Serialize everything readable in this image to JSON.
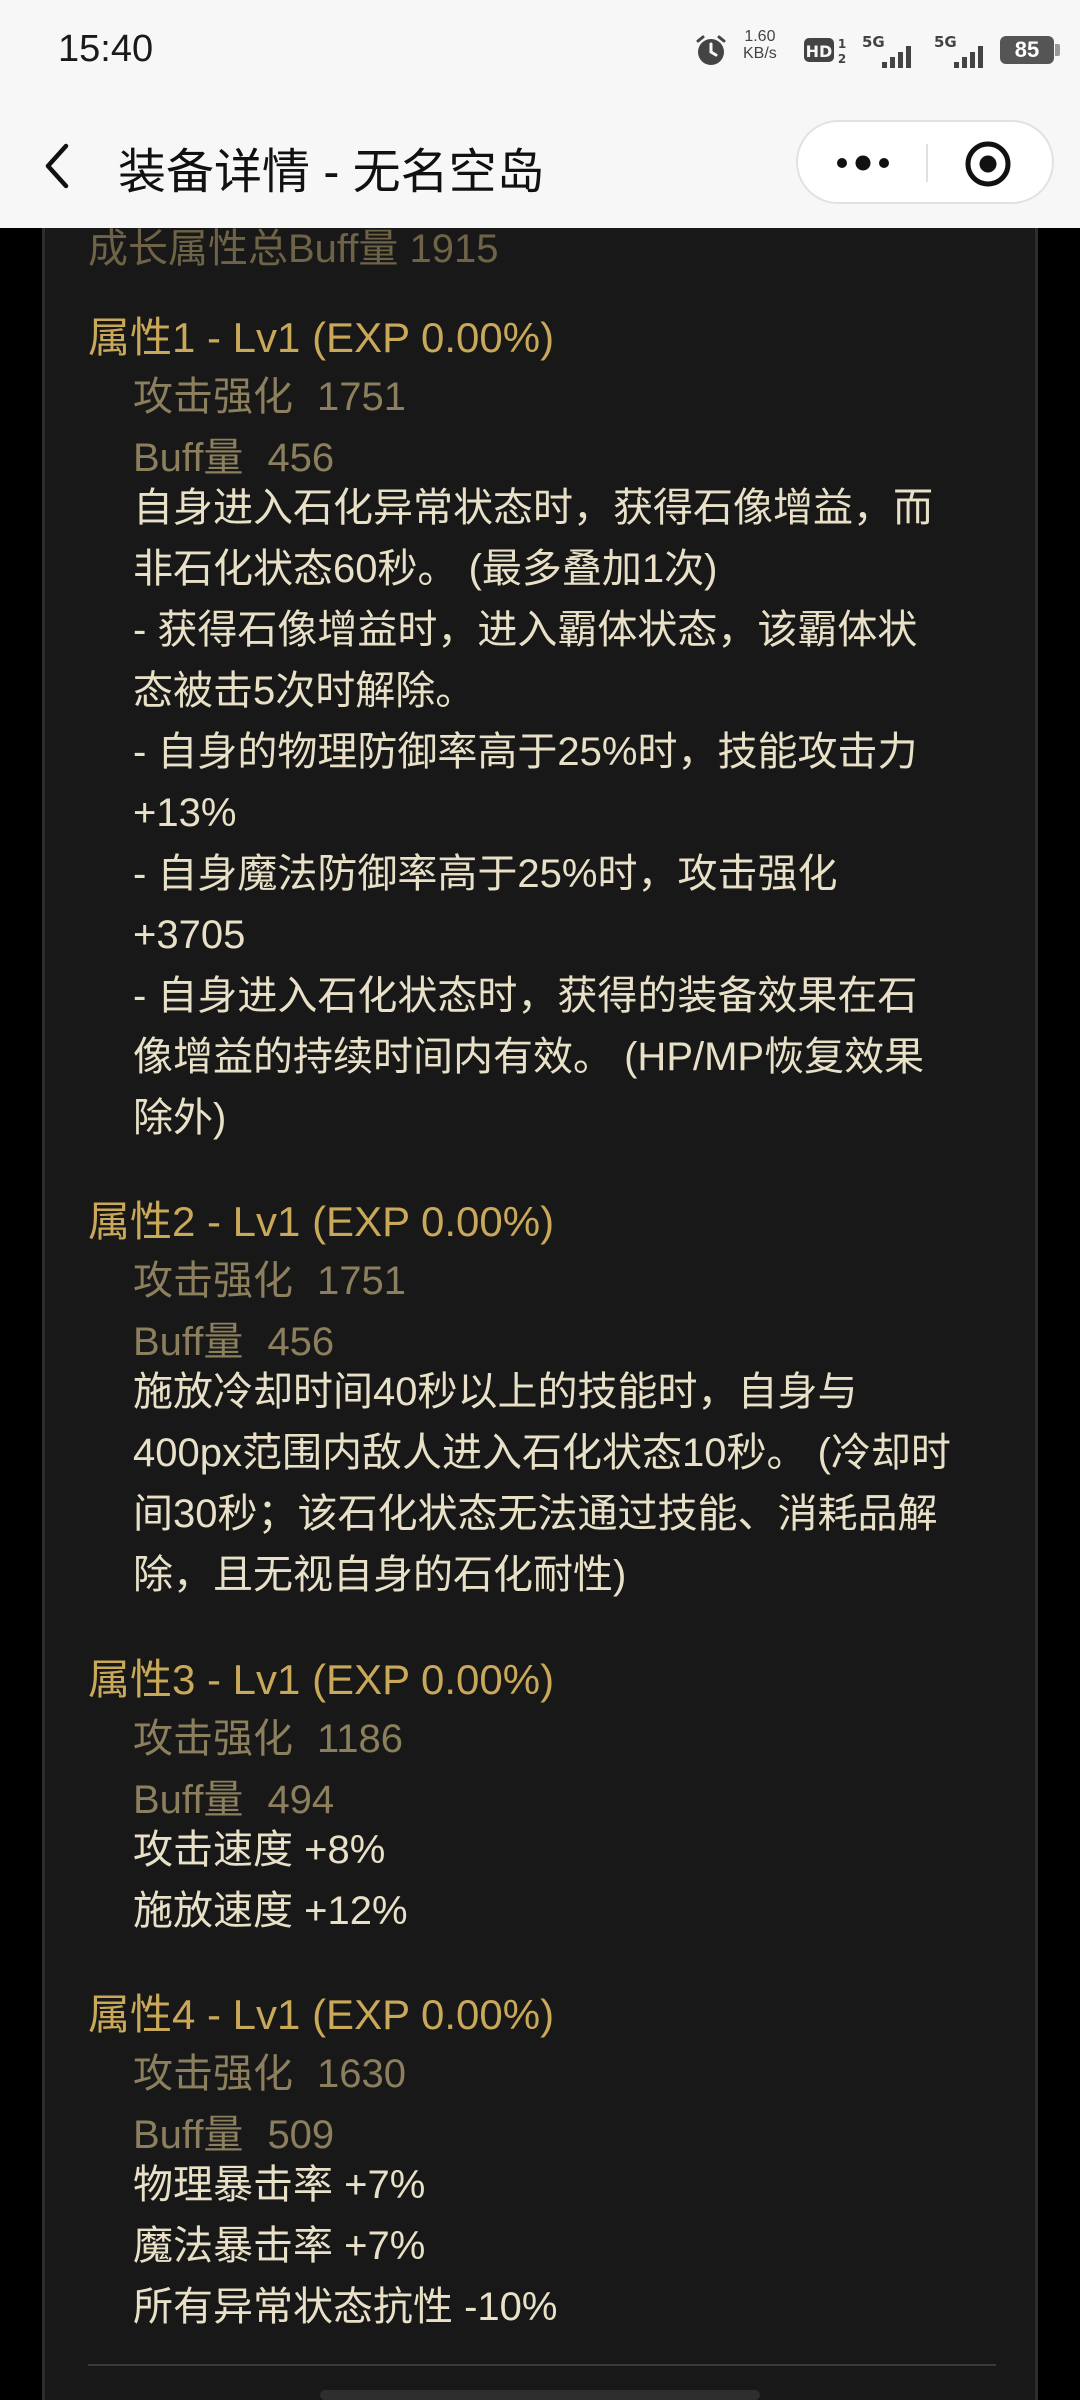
{
  "status_bar": {
    "time": "15:40",
    "net_speed_value": "1.60",
    "net_speed_unit": "KB/s",
    "hd_label": "HD",
    "signal1_label": "5G",
    "signal2_label": "5G",
    "battery": "85"
  },
  "nav": {
    "title": "装备详情 - 无名空岛"
  },
  "growth_total": "成长属性总Buff量 1915",
  "attributes": [
    {
      "title": "属性1 - Lv1 (EXP 0.00%)",
      "attack_label": "攻击强化",
      "attack_value": "1751",
      "buff_label": "Buff量",
      "buff_value": "456",
      "lines": [
        "自身进入石化异常状态时，获得石像增益，而",
        "非石化状态60秒。 (最多叠加1次)",
        "- 获得石像增益时，进入霸体状态，该霸体状",
        "态被击5次时解除。",
        "- 自身的物理防御率高于25%时，技能攻击力",
        "+13%",
        "- 自身魔法防御率高于25%时，攻击强化",
        "+3705",
        "- 自身进入石化状态时，获得的装备效果在石",
        "像增益的持续时间内有效。 (HP/MP恢复效果",
        "除外)"
      ]
    },
    {
      "title": "属性2 - Lv1 (EXP 0.00%)",
      "attack_label": "攻击强化",
      "attack_value": "1751",
      "buff_label": "Buff量",
      "buff_value": "456",
      "lines": [
        "施放冷却时间40秒以上的技能时，自身与",
        "400px范围内敌人进入石化状态10秒。 (冷却时",
        "间30秒；该石化状态无法通过技能、消耗品解",
        "除，且无视自身的石化耐性)"
      ]
    },
    {
      "title": "属性3 - Lv1 (EXP 0.00%)",
      "attack_label": "攻击强化",
      "attack_value": "1186",
      "buff_label": "Buff量",
      "buff_value": "494",
      "lines": [
        "攻击速度 +8%",
        "施放速度 +12%"
      ]
    },
    {
      "title": "属性4 - Lv1 (EXP 0.00%)",
      "attack_label": "攻击强化",
      "attack_value": "1630",
      "buff_label": "Buff量",
      "buff_value": "509",
      "lines": [
        "物理暴击率 +7%",
        "魔法暴击率 +7%",
        "所有异常状态抗性 -10%"
      ]
    }
  ]
}
